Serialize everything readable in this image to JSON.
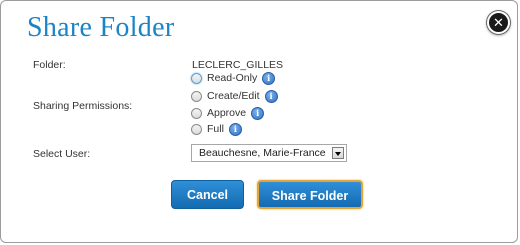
{
  "dialog": {
    "title": "Share Folder"
  },
  "folder": {
    "label": "Folder:",
    "value": "LECLERC_GILLES"
  },
  "permissions": {
    "label": "Sharing Permissions:",
    "options": [
      {
        "label": "Read-Only",
        "checked": true
      },
      {
        "label": "Create/Edit",
        "checked": false
      },
      {
        "label": "Approve",
        "checked": false
      },
      {
        "label": "Full",
        "checked": false
      }
    ],
    "info_glyph": "i"
  },
  "user": {
    "label": "Select User:",
    "selected": "Beauchesne, Marie-France"
  },
  "buttons": {
    "cancel": "Cancel",
    "share": "Share Folder"
  },
  "icons": {
    "close": "close-icon",
    "info": "info-icon"
  },
  "colors": {
    "title": "#1c84c6",
    "button": "#1f7cc4",
    "share_border": "#e2a537"
  }
}
